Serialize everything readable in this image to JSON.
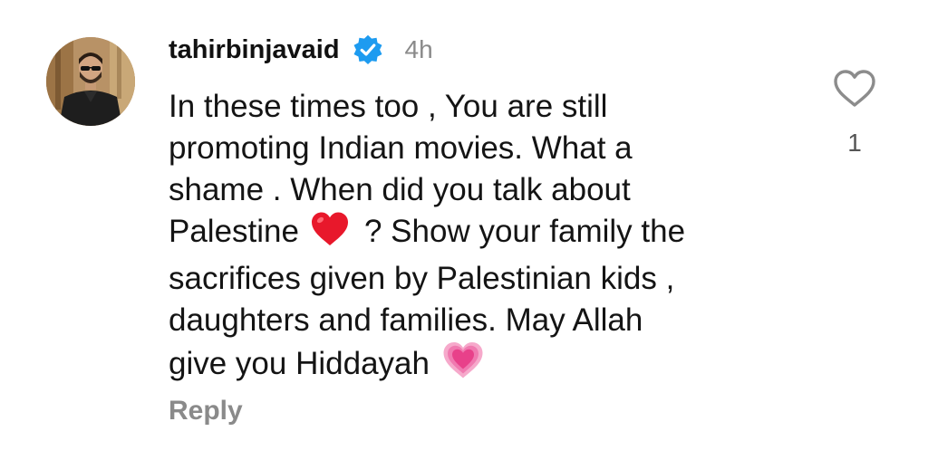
{
  "comment": {
    "username": "tahirbinjavaid",
    "verified_icon": "verified-badge-icon",
    "timestamp": "4h",
    "text_lines": [
      "In these times too , You are still",
      "promoting Indian movies. What a",
      "shame . When did you talk about",
      "Palestine",
      "? Show your family the",
      "sacrifices given by Palestinian kids ,",
      "daughters and families. May Allah",
      "give you Hiddayah"
    ],
    "emojis": {
      "red_heart": "red-heart-emoji",
      "pink_heart": "beating-pink-heart-emoji"
    },
    "reply_label": "Reply",
    "like_icon": "heart-outline-icon",
    "like_count": "1"
  },
  "colors": {
    "verified_blue": "#1d9bf0",
    "secondary_text": "#8a8a8a",
    "red_heart": "#e8182b",
    "pink_heart": "#ec4f95"
  }
}
